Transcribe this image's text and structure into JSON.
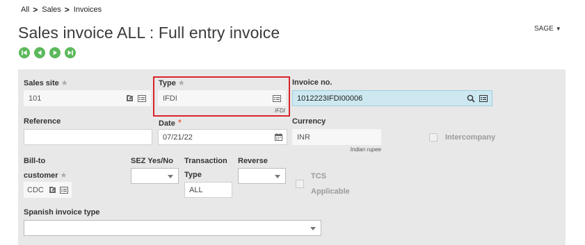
{
  "breadcrumb": [
    "All",
    "Sales",
    "Invoices"
  ],
  "title": "Sales invoice ALL : Full entry invoice",
  "sage_menu": "SAGE",
  "nav_icons": [
    "first-record-icon",
    "previous-record-icon",
    "next-record-icon",
    "last-record-icon"
  ],
  "colors": {
    "nav": "#5cb85c",
    "highlight": "#d9242b",
    "required": "#e04020",
    "invoice_field": "#cde8f0"
  },
  "form": {
    "sales_site": {
      "label": "Sales site",
      "value": "101"
    },
    "type": {
      "label": "Type",
      "value": "IFDI",
      "description": "IFDI"
    },
    "invoice_no": {
      "label": "Invoice no.",
      "value": "1012223IFDI00006"
    },
    "reference": {
      "label": "Reference",
      "value": ""
    },
    "date": {
      "label": "Date",
      "value": "07/21/22"
    },
    "currency": {
      "label": "Currency",
      "value": "INR",
      "description": "Indian rupee"
    },
    "intercompany": {
      "label": "Intercompany",
      "checked": false
    },
    "bill_to": {
      "label_line1": "Bill-to",
      "label_line2": "customer",
      "value": "CDC"
    },
    "sez": {
      "label": "SEZ Yes/No",
      "value": ""
    },
    "transaction_type": {
      "label_line1": "Transaction",
      "label_line2": "Type",
      "value": "ALL"
    },
    "reverse": {
      "label": "Reverse",
      "value": ""
    },
    "tcs": {
      "label_line1": "TCS",
      "label_line2": "Applicable",
      "checked": false
    },
    "spanish_invoice_type": {
      "label": "Spanish invoice type",
      "value": ""
    }
  }
}
